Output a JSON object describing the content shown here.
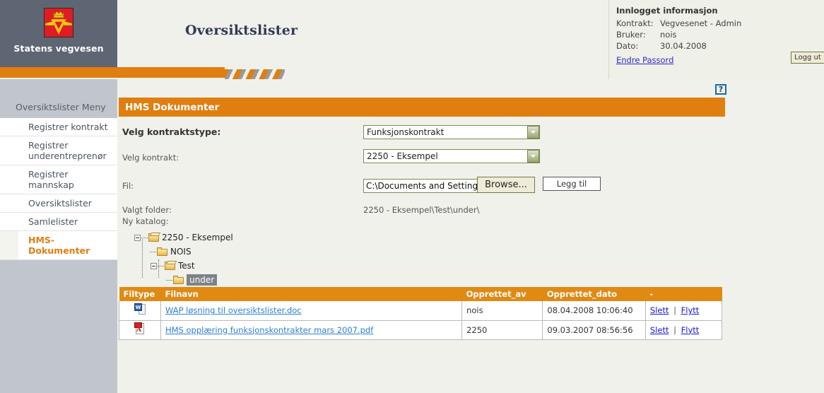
{
  "brand": {
    "caption": "Statens vegvesen",
    "logo_icon": "vegvesen-crown-wings-logo",
    "logo_bg": "#e11b22",
    "logo_fg": "#f5c518",
    "panel_bg": "#5d6672"
  },
  "header": {
    "page_title": "Oversiktslister",
    "accent_color": "#e07e10"
  },
  "info_box": {
    "title": "Innlogget informasjon",
    "rows": [
      {
        "label": "Kontrakt:",
        "value": "Vegvesenet - Admin"
      },
      {
        "label": "Bruker:",
        "value": "nois"
      },
      {
        "label": "Dato:",
        "value": "30.04.2008"
      }
    ],
    "change_password_link": "Endre Passord",
    "logout_button": "Logg ut"
  },
  "help": {
    "icon": "question-mark-help-icon",
    "glyph": "?"
  },
  "sidebar": {
    "heading": "Oversiktslister Meny",
    "items": [
      {
        "label": "Registrer kontrakt",
        "active": false
      },
      {
        "label": "Registrer underentreprenør",
        "active": false
      },
      {
        "label": "Registrer mannskap",
        "active": false
      },
      {
        "label": "Oversiktslister",
        "active": false
      },
      {
        "label": "Samlelister",
        "active": false
      },
      {
        "label": "HMS-Dokumenter",
        "active": true
      }
    ],
    "active_color": "#e07e10"
  },
  "section": {
    "title": "HMS Dokumenter"
  },
  "form": {
    "contract_type_label": "Velg kontraktstype:",
    "contract_type_value": "Funksjonskontrakt",
    "contract_type_options": [
      "Funksjonskontrakt"
    ],
    "contract_label": "Velg kontrakt:",
    "contract_value": "2250 - Eksempel",
    "contract_options": [
      "2250 - Eksempel"
    ],
    "file_label": "Fil:",
    "file_value": "C:\\Documents and Setting",
    "file_placeholder": "",
    "browse_button": "Browse...",
    "add_button": "Legg til",
    "dropdown_icon": "chevron-down-icon"
  },
  "tree": {
    "selected_folder_label": "Valgt folder:",
    "selected_folder_path": "2250 - Eksempel\\Test\\under\\",
    "new_catalog_label": "Ny katalog:",
    "nodes": [
      {
        "label": "2250 - Eksempel",
        "depth": 0,
        "expander": "minus",
        "icon": "folder-open-icon",
        "selected": false
      },
      {
        "label": "NOIS",
        "depth": 1,
        "expander": "none",
        "icon": "folder-closed-icon",
        "selected": false
      },
      {
        "label": "Test",
        "depth": 1,
        "expander": "minus",
        "icon": "folder-open-icon",
        "selected": false
      },
      {
        "label": "under",
        "depth": 2,
        "expander": "none",
        "icon": "folder-closed-icon",
        "selected": true
      }
    ]
  },
  "file_table": {
    "columns": [
      "Filtype",
      "Filnavn",
      "Opprettet_av",
      "Opprettet_dato",
      "-"
    ],
    "header_bg": "#e08a14",
    "rows": [
      {
        "filetype_icon": "word-document-icon",
        "filetype_badge": "W",
        "filename": "WAP løsning til oversiktslister.doc",
        "created_by": "nois",
        "created_date": "08.04.2008 10:06:40",
        "action_delete": "Slett",
        "action_move": "Flytt",
        "action_separator": "|"
      },
      {
        "filetype_icon": "pdf-document-icon",
        "filetype_badge": "A",
        "filename": "HMS opplæring funksjonskontrakter mars 2007.pdf",
        "created_by": "2250",
        "created_date": "09.03.2007 08:56:56",
        "action_delete": "Slett",
        "action_move": "Flytt",
        "action_separator": "|"
      }
    ]
  }
}
